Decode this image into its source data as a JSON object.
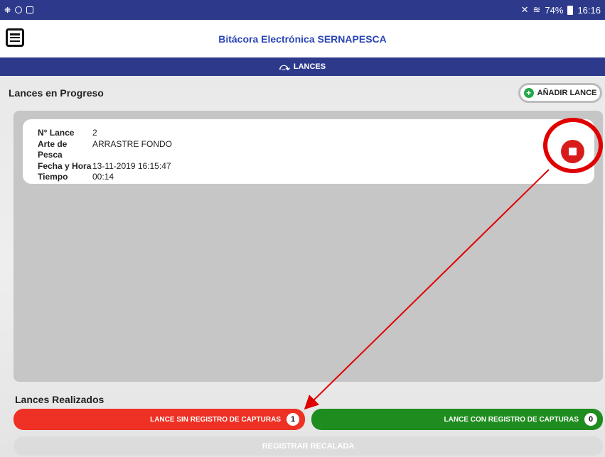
{
  "status_bar": {
    "battery": "74%",
    "time": "16:16"
  },
  "app_bar": {
    "title": "Bitácora Electrónica SERNAPESCA",
    "menu_icon": "menu-icon"
  },
  "section": {
    "title": "LANCES",
    "icon": "fishing-hand-icon"
  },
  "progress": {
    "heading": "Lances en Progreso",
    "add_button": "AÑADIR LANCE",
    "card": {
      "rows": [
        {
          "label": "N° Lance",
          "value": "2"
        },
        {
          "label": "Arte de Pesca",
          "value": "ARRASTRE FONDO"
        },
        {
          "label": "Fecha y Hora",
          "value": "13-11-2019 16:15:47"
        },
        {
          "label": "Tiempo",
          "value": "00:14"
        }
      ],
      "stop_icon": "stop-icon"
    }
  },
  "done": {
    "heading": "Lances Realizados",
    "without_captures": {
      "label": "LANCE SIN REGISTRO DE CAPTURAS",
      "count": "1"
    },
    "with_captures": {
      "label": "LANCE CON REGISTRO DE CAPTURAS",
      "count": "0"
    },
    "recalada_button": "REGISTRAR RECALADA"
  },
  "colors": {
    "primary": "#2d3a8c",
    "title_blue": "#2a45b8",
    "red": "#ee3124",
    "green": "#1f8c1f",
    "annotation_red": "#e00000"
  }
}
